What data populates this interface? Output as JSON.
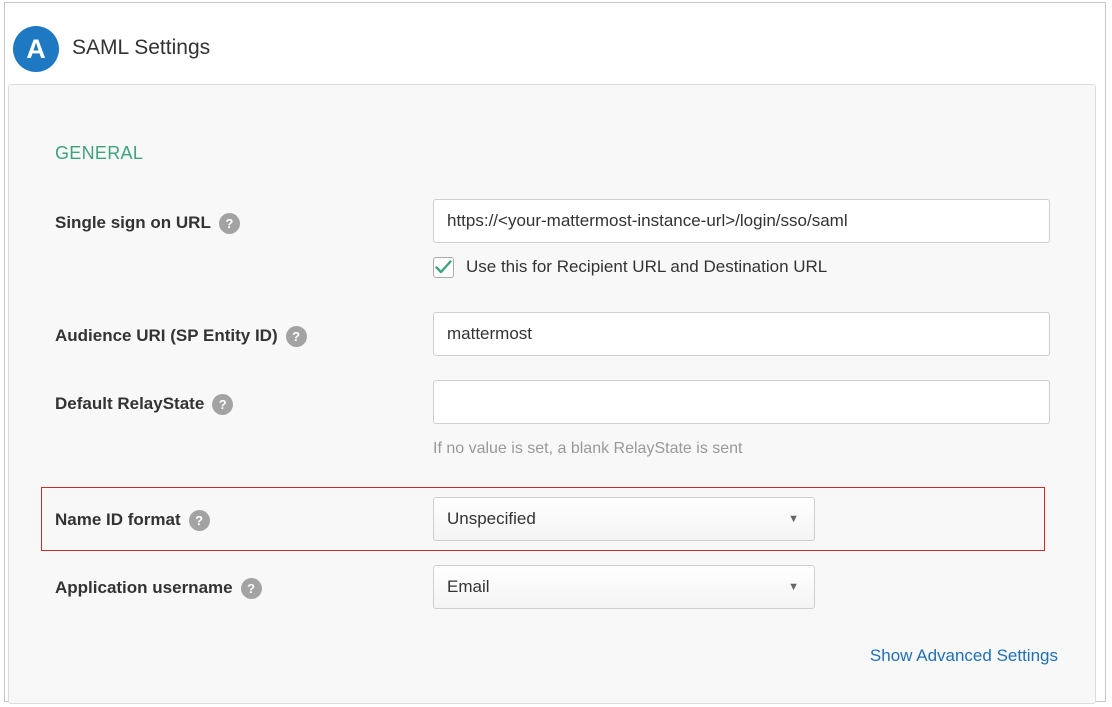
{
  "header": {
    "badge_letter": "A",
    "title": "SAML Settings"
  },
  "section": {
    "title": "GENERAL"
  },
  "fields": {
    "sso_url": {
      "label": "Single sign on URL",
      "value": "https://<your-mattermost-instance-url>/login/sso/saml",
      "checkbox_label": "Use this for Recipient URL and Destination URL",
      "checkbox_checked": true
    },
    "audience_uri": {
      "label": "Audience URI (SP Entity ID)",
      "value": "mattermost"
    },
    "relay_state": {
      "label": "Default RelayState",
      "value": "",
      "hint": "If no value is set, a blank RelayState is sent"
    },
    "name_id_format": {
      "label": "Name ID format",
      "selected": "Unspecified"
    },
    "app_username": {
      "label": "Application username",
      "selected": "Email"
    }
  },
  "help_glyph": "?",
  "dropdown_arrow": "▼",
  "advanced_link": "Show Advanced Settings",
  "colors": {
    "badge": "#1f79c2",
    "section_title": "#3fa37c",
    "checkmark": "#3fa37c",
    "link": "#1f6fb5",
    "highlight": "#d22a2a"
  }
}
